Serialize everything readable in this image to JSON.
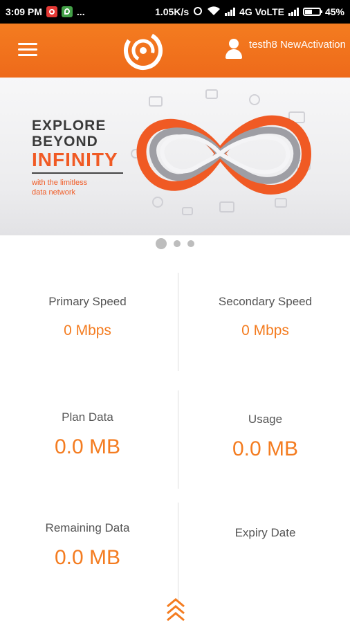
{
  "status_bar": {
    "time": "3:09 PM",
    "dots": "...",
    "speed": "1.05K/s",
    "network": "4G VoLTE",
    "battery": "45%"
  },
  "app_bar": {
    "username": "testh8 NewActivation"
  },
  "banner": {
    "line1": "EXPLORE",
    "line2": "BEYOND",
    "line3": "INFINITY",
    "sub1": "with the limitless",
    "sub2": "data network"
  },
  "carousel": {
    "dots": 3,
    "active_index": 0
  },
  "stats": {
    "primary_speed": {
      "label": "Primary Speed",
      "value": "0 Mbps"
    },
    "secondary_speed": {
      "label": "Secondary Speed",
      "value": "0 Mbps"
    },
    "plan_data": {
      "label": "Plan Data",
      "value": "0.0 MB"
    },
    "usage": {
      "label": "Usage",
      "value": "0.0 MB"
    },
    "remaining_data": {
      "label": "Remaining Data",
      "value": "0.0 MB"
    },
    "expiry_date": {
      "label": "Expiry Date",
      "value": ""
    }
  },
  "colors": {
    "accent": "#f47c20",
    "banner_orange": "#f05a24",
    "status_bar": "#000000"
  },
  "icons": [
    "whatsapp-icon",
    "notification-icon",
    "wifi-icon",
    "signal-icon",
    "battery-icon",
    "menu-icon",
    "logo-icon",
    "user-icon",
    "double-chevron-up-icon"
  ]
}
